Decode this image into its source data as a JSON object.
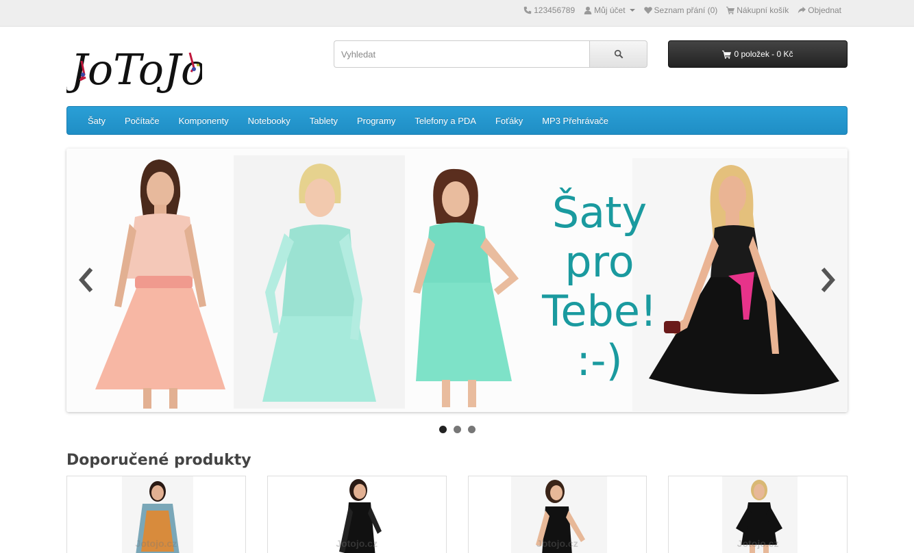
{
  "topbar": {
    "phone": "123456789",
    "account": "Můj účet",
    "wishlist": "Seznam přání (0)",
    "cart": "Nákupní košík",
    "checkout": "Objednat"
  },
  "logo": {
    "text": "JoToJo"
  },
  "search": {
    "placeholder": "Vyhledat"
  },
  "cart_button": {
    "label": "0 položek - 0 Kč"
  },
  "menu": {
    "items": [
      "Šaty",
      "Počítače",
      "Komponenty",
      "Notebooky",
      "Tablety",
      "Programy",
      "Telefony a PDA",
      "Foťáky",
      "MP3 Přehrávače"
    ]
  },
  "slideshow": {
    "text_lines": [
      "Šaty",
      "pro",
      "Tebe!",
      ":-)"
    ],
    "slides_count": 3,
    "active_slide": 1
  },
  "featured": {
    "title": "Doporučené produkty",
    "products": [
      {
        "watermark": "Jotojo.cz"
      },
      {
        "watermark": "Jotojo.cz"
      },
      {
        "watermark": "Jotojo.cz"
      },
      {
        "watermark": "Jotojo.cz"
      }
    ]
  },
  "colors": {
    "menu": "#2a9fd6",
    "slide_text": "#1a9a9f",
    "cart_bg": "#333333"
  }
}
